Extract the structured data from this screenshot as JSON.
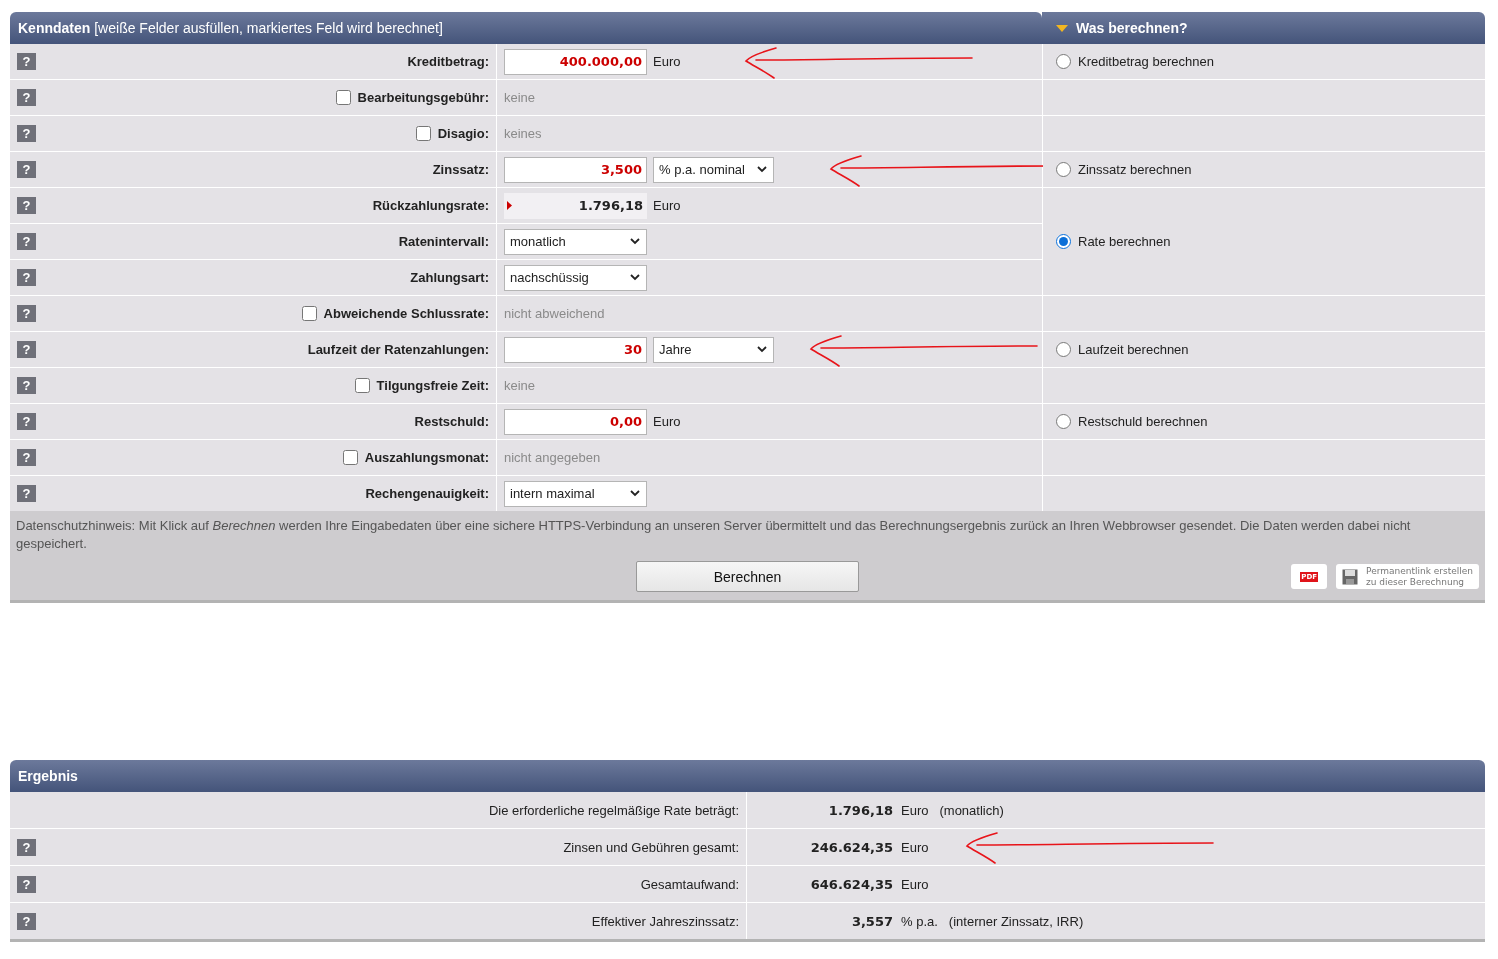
{
  "form": {
    "title": "**Kenndaten** [weiße Felder ausfüllen, markiertes Feld wird berechnet]",
    "choice_title": "Was berechnen?",
    "rows": [
      {
        "help": "?",
        "label": "Kreditbetrag:",
        "kind": "input",
        "value": "400.000,00",
        "unit": "Euro",
        "annotated": true,
        "choice": {
          "label": "Kreditbetrag berechnen",
          "selected": false
        }
      },
      {
        "help": "?",
        "label": "Bearbeitungsgebühr:",
        "kind": "toggle",
        "checked": false,
        "value": "keine"
      },
      {
        "help": "?",
        "label": "Disagio:",
        "kind": "toggle",
        "checked": false,
        "value": "keines"
      },
      {
        "help": "?",
        "label": "Zinssatz:",
        "kind": "input",
        "value": "3,500",
        "option": "% p.a. nominal",
        "annotated": true,
        "choice": {
          "label": "Zinssatz berechnen",
          "selected": false
        }
      },
      {
        "help": "?",
        "label": "Rückzahlungsrate:",
        "kind": "computed",
        "value": "1.796,18",
        "unit": "Euro",
        "choice": {
          "label": "Rate berechnen",
          "selected": true
        }
      },
      {
        "help": "?",
        "label": "Ratenintervall:",
        "kind": "select",
        "option": "monatlich",
        "choice_merged": true
      },
      {
        "help": "?",
        "label": "Zahlungsart:",
        "kind": "select",
        "option": "nachschüssig",
        "choice_merged": true
      },
      {
        "help": "?",
        "label": "Abweichende Schlussrate:",
        "kind": "toggle",
        "checked": false,
        "value": "nicht abweichend"
      },
      {
        "help": "?",
        "label": "Laufzeit der Ratenzahlungen:",
        "kind": "input",
        "value": "30",
        "option": "Jahre",
        "annotated": true,
        "choice": {
          "label": "Laufzeit berechnen",
          "selected": false
        }
      },
      {
        "help": "?",
        "label": "Tilgungsfreie Zeit:",
        "kind": "toggle",
        "checked": false,
        "value": "keine"
      },
      {
        "help": "?",
        "label": "Restschuld:",
        "kind": "input",
        "value": "0,00",
        "unit": "Euro",
        "choice": {
          "label": "Restschuld berechnen",
          "selected": false
        }
      },
      {
        "help": "?",
        "label": "Auszahlungsmonat:",
        "kind": "toggle",
        "checked": false,
        "value": "nicht angegeben"
      },
      {
        "help": "?",
        "label": "Rechengenauigkeit:",
        "kind": "select",
        "option": "intern maximal"
      }
    ],
    "privacy_note": "Datenschutzhinweis: Mit Klick auf *Berechnen* werden Ihre Eingabedaten über eine sichere HTTPS-Verbindung an unseren Server übermittelt und das Berechnungsergebnis zurück an Ihren Webbrowser gesendet. Die Daten werden dabei nicht gespeichert.",
    "submit": "Berechnen",
    "pdf_label": "PDF",
    "permalink": [
      "Permanentlink erstellen",
      "zu dieser Berechnung"
    ]
  },
  "result": {
    "title": "Ergebnis",
    "rows": [
      {
        "label": "Die erforderliche regelmäßige Rate beträgt:",
        "value": "1.796,18",
        "unit": "Euro",
        "note": "(monatlich)"
      },
      {
        "help": "?",
        "label": "Zinsen und Gebühren gesamt:",
        "value": "246.624,35",
        "unit": "Euro",
        "annotated": true
      },
      {
        "help": "?",
        "label": "Gesamtaufwand:",
        "value": "646.624,35",
        "unit": "Euro"
      },
      {
        "help": "?",
        "label": "Effektiver Jahreszinssatz:",
        "value": "3,557",
        "unit": "% p.a.",
        "note": "(interner Zinssatz, IRR)"
      }
    ]
  }
}
